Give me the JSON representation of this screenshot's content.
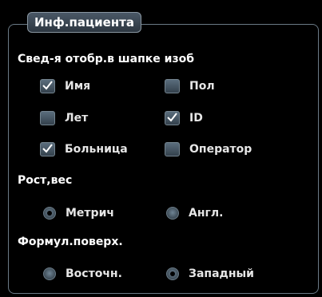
{
  "tab": {
    "label": "Инф.пациента"
  },
  "sections": {
    "header_display": {
      "title": "Свед-я отобр.в шапке изоб",
      "options": [
        {
          "label": "Имя",
          "checked": true
        },
        {
          "label": "Пол",
          "checked": false
        },
        {
          "label": "Лет",
          "checked": false
        },
        {
          "label": "ID",
          "checked": true
        },
        {
          "label": "Больница",
          "checked": true
        },
        {
          "label": "Оператор",
          "checked": false
        }
      ]
    },
    "height_weight": {
      "title": "Рост,вес",
      "options": [
        {
          "label": "Метрич",
          "selected": true
        },
        {
          "label": "Англ.",
          "selected": false
        }
      ]
    },
    "surface_formula": {
      "title": "Формул.поверх.",
      "options": [
        {
          "label": "Восточн.",
          "selected": false
        },
        {
          "label": "Западный",
          "selected": true
        }
      ]
    }
  },
  "colors": {
    "background": "#000000",
    "panel_border": "#6a7a86",
    "control": "#4a5c6a",
    "text": "#e6e6e6"
  }
}
